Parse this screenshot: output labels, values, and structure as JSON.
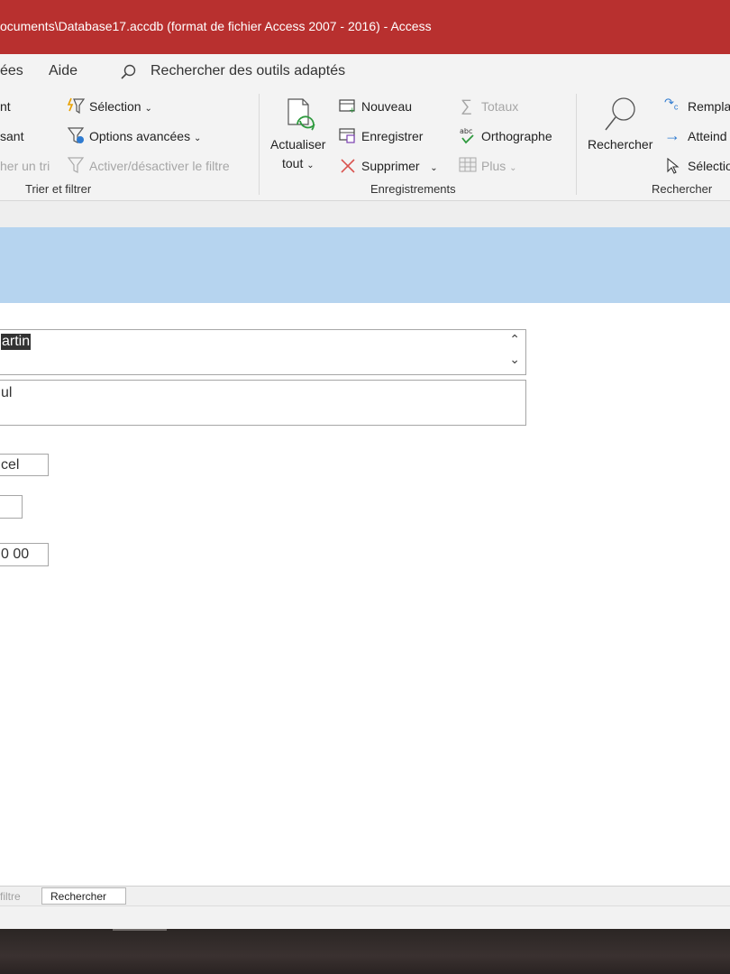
{
  "window": {
    "title": "ocuments\\Database17.accdb (format de fichier Access 2007 - 2016)  -  Access"
  },
  "menu": {
    "items": [
      "ées",
      "Aide"
    ],
    "search_label": "Rechercher des outils adaptés"
  },
  "ribbon": {
    "sort_filter": {
      "btn1": "nt",
      "btn2": "sant",
      "btn3": "her un tri",
      "selection": "Sélection",
      "advanced": "Options avancées",
      "toggle_filter": "Activer/désactiver le filtre",
      "group": "Trier et filtrer"
    },
    "records": {
      "refresh_line1": "Actualiser",
      "refresh_line2": "tout",
      "new": "Nouveau",
      "save": "Enregistrer",
      "delete": "Supprimer",
      "totals": "Totaux",
      "spelling": "Orthographe",
      "more": "Plus",
      "group": "Enregistrements"
    },
    "find": {
      "find_btn": "Rechercher",
      "replace": "Rempla",
      "goto": "Atteind",
      "select": "Sélectio",
      "group": "Rechercher"
    }
  },
  "form": {
    "field1_value": "artin",
    "field2_value": "ul",
    "field3_value": "cel",
    "field4_value": "",
    "field5_value": "0 00"
  },
  "status": {
    "filter_label": "filtre",
    "search_label": "Rechercher"
  },
  "colors": {
    "title_bar": "#b8302f",
    "form_header": "#b6d4ef",
    "ribbon_bg": "#f3f3f3"
  }
}
